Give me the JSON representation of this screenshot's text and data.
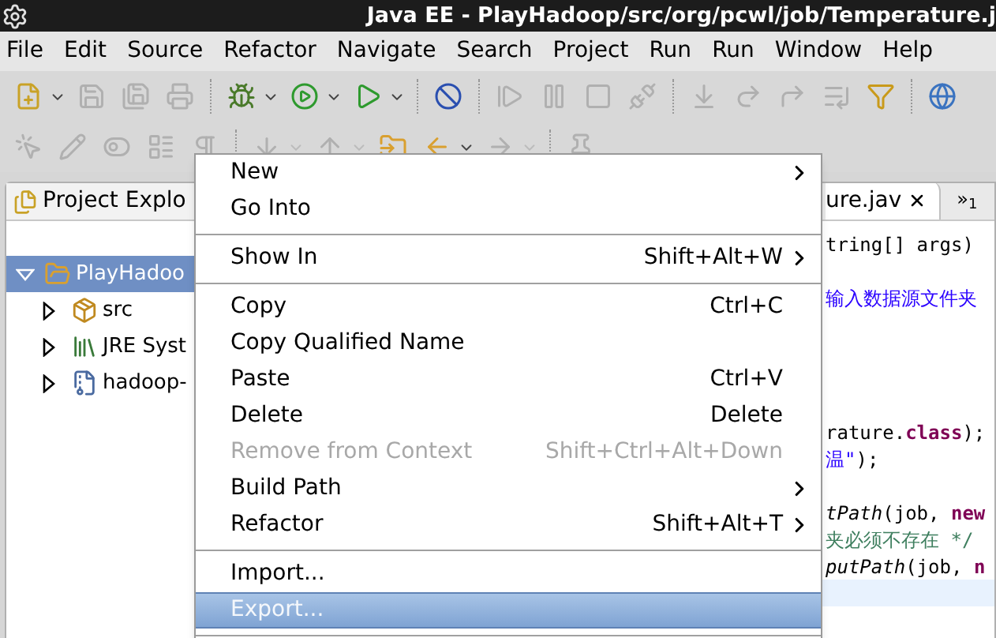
{
  "window": {
    "title": "Java EE - PlayHadoop/src/org/pcwl/job/Temperature.j"
  },
  "menubar": [
    "File",
    "Edit",
    "Source",
    "Refactor",
    "Navigate",
    "Search",
    "Project",
    "Run",
    "Run",
    "Window",
    "Help"
  ],
  "toolbar_1": [
    {
      "kind": "new",
      "disabled": false,
      "dropdown": true
    },
    {
      "kind": "save",
      "disabled": true
    },
    {
      "kind": "save-all",
      "disabled": true
    },
    {
      "kind": "print",
      "disabled": true
    },
    {
      "kind": "sep"
    },
    {
      "kind": "debug",
      "disabled": false,
      "dropdown": true
    },
    {
      "kind": "run",
      "disabled": false,
      "dropdown": true
    },
    {
      "kind": "run-external",
      "disabled": false,
      "dropdown": true
    },
    {
      "kind": "sep"
    },
    {
      "kind": "skip",
      "disabled": false
    },
    {
      "kind": "sep"
    },
    {
      "kind": "resume",
      "disabled": true
    },
    {
      "kind": "pause",
      "disabled": true
    },
    {
      "kind": "stop",
      "disabled": true
    },
    {
      "kind": "disconnect",
      "disabled": true
    },
    {
      "kind": "sep"
    },
    {
      "kind": "step-into",
      "disabled": true
    },
    {
      "kind": "step-over",
      "disabled": true
    },
    {
      "kind": "step-return",
      "disabled": true
    },
    {
      "kind": "drop",
      "disabled": true
    },
    {
      "kind": "filter",
      "disabled": false
    },
    {
      "kind": "sep"
    },
    {
      "kind": "globe",
      "disabled": false
    }
  ],
  "toolbar_2": [
    {
      "kind": "open-type",
      "disabled": true
    },
    {
      "kind": "pen",
      "disabled": true
    },
    {
      "kind": "toggle",
      "disabled": true
    },
    {
      "kind": "block",
      "disabled": true
    },
    {
      "kind": "para",
      "disabled": true
    },
    {
      "kind": "sep"
    },
    {
      "kind": "next",
      "disabled": true,
      "dropdown": true
    },
    {
      "kind": "prev",
      "disabled": true,
      "dropdown": true
    },
    {
      "kind": "last-edit",
      "disabled": false
    },
    {
      "kind": "back",
      "disabled": false,
      "dropdown": true
    },
    {
      "kind": "forward",
      "disabled": true,
      "dropdown": true
    },
    {
      "kind": "sep"
    },
    {
      "kind": "pin",
      "disabled": true
    }
  ],
  "explorer": {
    "tab": "Project Explo",
    "tree": [
      {
        "label": "PlayHadoo",
        "kind": "project",
        "expanded": true,
        "selected": true,
        "children": [
          {
            "label": "src",
            "kind": "package",
            "expanded": false,
            "selected": false
          },
          {
            "label": "JRE Syst",
            "kind": "library",
            "expanded": false,
            "selected": false
          },
          {
            "label": "hadoop-",
            "kind": "jar",
            "expanded": false,
            "selected": false
          }
        ]
      }
    ]
  },
  "editor": {
    "tab": "ure.jav",
    "overflow": "»$_{1}$",
    "lines": [
      {
        "current": false,
        "segments": [
          {
            "kind": "plain",
            "text": "tring[] args)"
          }
        ]
      },
      {
        "current": false
      },
      {
        "current": false,
        "segments": [
          {
            "kind": "string",
            "text": "输入数据源文件夹"
          }
        ]
      },
      {
        "current": false
      },
      {
        "current": false
      },
      {
        "current": false
      },
      {
        "current": false
      },
      {
        "current": false,
        "segments": [
          {
            "kind": "plain",
            "text": "rature."
          },
          {
            "kind": "keyword",
            "text": "class"
          },
          {
            "kind": "plain",
            "text": ");"
          }
        ]
      },
      {
        "current": false,
        "segments": [
          {
            "kind": "string",
            "text": "温\""
          },
          {
            "kind": "plain",
            "text": ");"
          }
        ]
      },
      {
        "current": false
      },
      {
        "current": false,
        "segments": [
          {
            "kind": "method",
            "text": "tPath"
          },
          {
            "kind": "plain",
            "text": "(job, "
          },
          {
            "kind": "keyword",
            "text": "new"
          }
        ]
      },
      {
        "current": false,
        "segments": [
          {
            "kind": "comment",
            "text": "夹必须不存在 */"
          }
        ]
      },
      {
        "current": false,
        "segments": [
          {
            "kind": "method",
            "text": "putPath"
          },
          {
            "kind": "plain",
            "text": "(job, "
          },
          {
            "kind": "keyword",
            "text": "n"
          }
        ]
      },
      {
        "current": true
      }
    ]
  },
  "context_menu": [
    {
      "kind": "item",
      "label": "New",
      "submenu": true,
      "disabled": false,
      "selected": false
    },
    {
      "kind": "item",
      "label": "Go Into",
      "submenu": false,
      "disabled": false,
      "selected": false
    },
    {
      "kind": "separator"
    },
    {
      "kind": "item",
      "label": "Show In",
      "shortcut": "Shift+Alt+W",
      "submenu": true,
      "disabled": false,
      "selected": false
    },
    {
      "kind": "separator"
    },
    {
      "kind": "item",
      "label": "Copy",
      "shortcut": "Ctrl+C",
      "submenu": false,
      "disabled": false,
      "selected": false
    },
    {
      "kind": "item",
      "label": "Copy Qualified Name",
      "submenu": false,
      "disabled": false,
      "selected": false
    },
    {
      "kind": "item",
      "label": "Paste",
      "shortcut": "Ctrl+V",
      "submenu": false,
      "disabled": false,
      "selected": false
    },
    {
      "kind": "item",
      "label": "Delete",
      "shortcut": "Delete",
      "submenu": false,
      "disabled": false,
      "selected": false
    },
    {
      "kind": "item",
      "label": "Remove from Context",
      "shortcut": "Shift+Ctrl+Alt+Down",
      "submenu": false,
      "disabled": true,
      "selected": false
    },
    {
      "kind": "item",
      "label": "Build Path",
      "submenu": true,
      "disabled": false,
      "selected": false
    },
    {
      "kind": "item",
      "label": "Refactor",
      "shortcut": "Shift+Alt+T",
      "submenu": true,
      "disabled": false,
      "selected": false
    },
    {
      "kind": "separator"
    },
    {
      "kind": "item",
      "label": "Import...",
      "submenu": false,
      "disabled": false,
      "selected": false
    },
    {
      "kind": "item",
      "label": "Export...",
      "submenu": false,
      "disabled": false,
      "selected": true
    },
    {
      "kind": "separator"
    }
  ]
}
